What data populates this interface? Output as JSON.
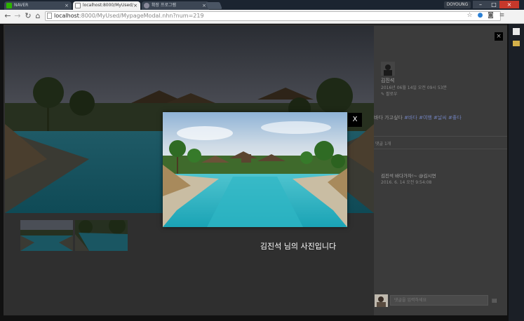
{
  "browser": {
    "tabs": [
      {
        "label": "NAVER",
        "active": false
      },
      {
        "label": "localhost:8000/MyUsed/",
        "active": true
      },
      {
        "label": "확장 프로그램",
        "active": false
      }
    ],
    "profile": "DOYOUNG",
    "url_host": "localhost",
    "url_path": ":8000/MyUsed/MypageModal.nhn?num=219",
    "icons": {
      "back": "back-arrow-icon",
      "forward": "forward-arrow-icon",
      "reload": "reload-icon",
      "home": "home-icon",
      "star": "bookmark-star-icon",
      "menu": "menu-icon"
    }
  },
  "post": {
    "author": "김진석",
    "date": "2016년 06월 14일 오전 09시 53분",
    "follow": "팔로우",
    "body": "바다 가고싶다",
    "hashtags": "#바다 #여행 #날씨 #좋다",
    "comment_count": "댓글 1개",
    "comment_text": "김진석 바다가자!~ @김시연",
    "comment_date": "2016. 6. 14 오전 9:54:08"
  },
  "modal": {
    "close": "X",
    "caption": "김진석 님의 사진입니다"
  },
  "comment_input": {
    "placeholder": "댓글을 입력하세요"
  },
  "colors": {
    "hashtag": "#6f7fb8",
    "modal_bg": "#000000"
  }
}
